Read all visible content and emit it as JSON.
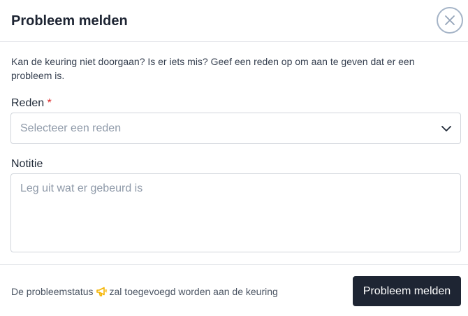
{
  "dialog": {
    "title": "Probleem melden",
    "close_icon": "close-icon",
    "description": "Kan de keuring niet doorgaan? Is er iets mis? Geef een reden op om aan te geven dat er een probleem is."
  },
  "form": {
    "reason": {
      "label": "Reden",
      "required_marker": "*",
      "placeholder": "Selecteer een reden",
      "icon": "chevron-down-icon"
    },
    "note": {
      "label": "Notitie",
      "placeholder": "Leg uit wat er gebeurd is"
    }
  },
  "footer": {
    "note_before": "De probleemstatus",
    "status_icon": "megaphone-icon",
    "status_icon_color": "#f5b400",
    "note_after": "zal toegevoegd worden aan de keuring",
    "submit_label": "Probleem melden"
  },
  "colors": {
    "primary_button": "#1e2533",
    "required": "#dc2626",
    "close_ring": "#a5b4c7"
  }
}
